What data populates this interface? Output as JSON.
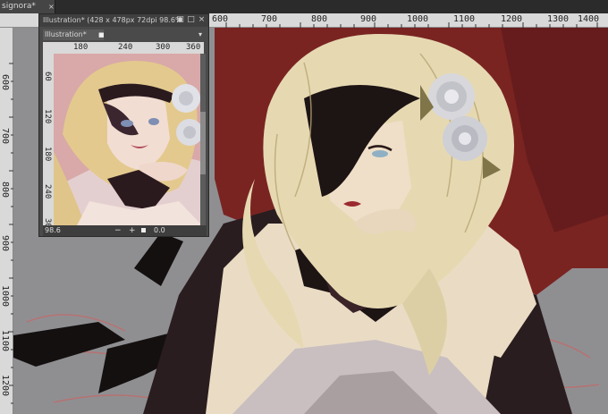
{
  "document_tab": {
    "label": "signora*",
    "close_glyph": "×"
  },
  "ruler_top": {
    "labels": [
      "600",
      "700",
      "800",
      "900",
      "1000",
      "1100",
      "1200",
      "1300",
      "1400"
    ]
  },
  "ruler_left": {
    "labels": [
      "600",
      "700",
      "800",
      "900",
      "1000",
      "1100",
      "1200"
    ]
  },
  "navigator": {
    "title": "Illustration* (428 x 478px 72dpi 98.6%",
    "window_buttons": {
      "pin": "▣",
      "float": "□",
      "close": "×"
    },
    "canvas_select": "Illustration*",
    "dropdown_arrow": "▾",
    "ruler_top": [
      "180",
      "240",
      "300",
      "360"
    ],
    "ruler_left": [
      "60",
      "120",
      "180",
      "240",
      "300"
    ],
    "zoom": "98.6",
    "minus": "−",
    "plus": "+",
    "rotation": "0.0"
  },
  "colors": {
    "workspace": "#3a3a3a",
    "ruler": "#d9d9d9",
    "canvas_gray": "#8f8f92",
    "backdrop_red": "#7a2422",
    "skin": "#eadcc4",
    "hair": "#e6d9b2",
    "dark": "#1d1414"
  }
}
